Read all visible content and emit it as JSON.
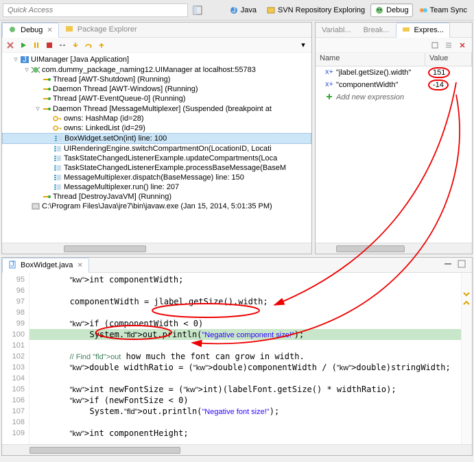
{
  "toolbar": {
    "quick_access_placeholder": "Quick Access",
    "perspectives": [
      {
        "label": "Java"
      },
      {
        "label": "SVN Repository Exploring"
      },
      {
        "label": "Debug",
        "active": true
      },
      {
        "label": "Team Sync"
      }
    ]
  },
  "debug": {
    "tabs": [
      {
        "label": "Debug",
        "active": true
      },
      {
        "label": "Package Explorer"
      }
    ],
    "tree": [
      {
        "indent": 0,
        "tw": "▿",
        "icon": "j",
        "text": "UIManager [Java Application]"
      },
      {
        "indent": 1,
        "tw": "▿",
        "icon": "bug",
        "text": "com.dummy_package_naming12.UIManager at localhost:55783"
      },
      {
        "indent": 2,
        "tw": "",
        "icon": "thr",
        "text": "Thread [AWT-Shutdown] (Running)"
      },
      {
        "indent": 2,
        "tw": "",
        "icon": "thr",
        "text": "Daemon Thread [AWT-Windows] (Running)"
      },
      {
        "indent": 2,
        "tw": "",
        "icon": "thr",
        "text": "Thread [AWT-EventQueue-0] (Running)"
      },
      {
        "indent": 2,
        "tw": "▿",
        "icon": "thr",
        "text": "Daemon Thread [MessageMultiplexer] (Suspended (breakpoint at"
      },
      {
        "indent": 3,
        "tw": "",
        "icon": "key",
        "text": "owns: HashMap<K,V>  (id=28)"
      },
      {
        "indent": 3,
        "tw": "",
        "icon": "key",
        "text": "owns: LinkedList<E>  (id=29)"
      },
      {
        "indent": 3,
        "tw": "",
        "icon": "sf",
        "text": "BoxWidget.setOn(int) line: 100",
        "sel": true
      },
      {
        "indent": 3,
        "tw": "",
        "icon": "sf",
        "text": "UIRenderingEngine.switchCompartmentOn(LocationID, Locati"
      },
      {
        "indent": 3,
        "tw": "",
        "icon": "sf",
        "text": "TaskStateChangedListenerExample.updateCompartments(Loca"
      },
      {
        "indent": 3,
        "tw": "",
        "icon": "sf",
        "text": "TaskStateChangedListenerExample.processBaseMessage(BaseM"
      },
      {
        "indent": 3,
        "tw": "",
        "icon": "sf",
        "text": "MessageMultiplexer.dispatch(BaseMessage) line: 150"
      },
      {
        "indent": 3,
        "tw": "",
        "icon": "sf",
        "text": "MessageMultiplexer.run() line: 207"
      },
      {
        "indent": 2,
        "tw": "",
        "icon": "thr",
        "text": "Thread [DestroyJavaVM] (Running)"
      },
      {
        "indent": 1,
        "tw": "",
        "icon": "proc",
        "text": "C:\\Program Files\\Java\\jre7\\bin\\javaw.exe (Jan 15, 2014, 5:01:35 PM)"
      }
    ]
  },
  "vars": {
    "tabs": [
      {
        "label": "Variabl..."
      },
      {
        "label": "Break..."
      },
      {
        "label": "Expres...",
        "active": true
      }
    ],
    "cols": {
      "name": "Name",
      "value": "Value"
    },
    "rows": [
      {
        "name": "\"jlabel.getSize().width\"",
        "value": "151"
      },
      {
        "name": "\"componentWidth\"",
        "value": "-14"
      }
    ],
    "add": "Add new expression"
  },
  "editor": {
    "tab": "BoxWidget.java",
    "lines": {
      "95": "       int componentWidth;",
      "96": "",
      "97": "       componentWidth = jlabel.getSize().width;",
      "98": "",
      "99": "       if (componentWidth < 0)",
      "100": "           System.out.println(\"Negative component size!\");",
      "101": "",
      "102": "       // Find out how much the font can grow in width.",
      "103": "       double widthRatio = (double)componentWidth / (double)stringWidth;",
      "104": "",
      "105": "       int newFontSize = (int)(labelFont.getSize() * widthRatio);",
      "106": "       if (newFontSize < 0)",
      "107": "           System.out.println(\"Negative font size!\");",
      "108": "",
      "109": "       int componentHeight;"
    }
  }
}
